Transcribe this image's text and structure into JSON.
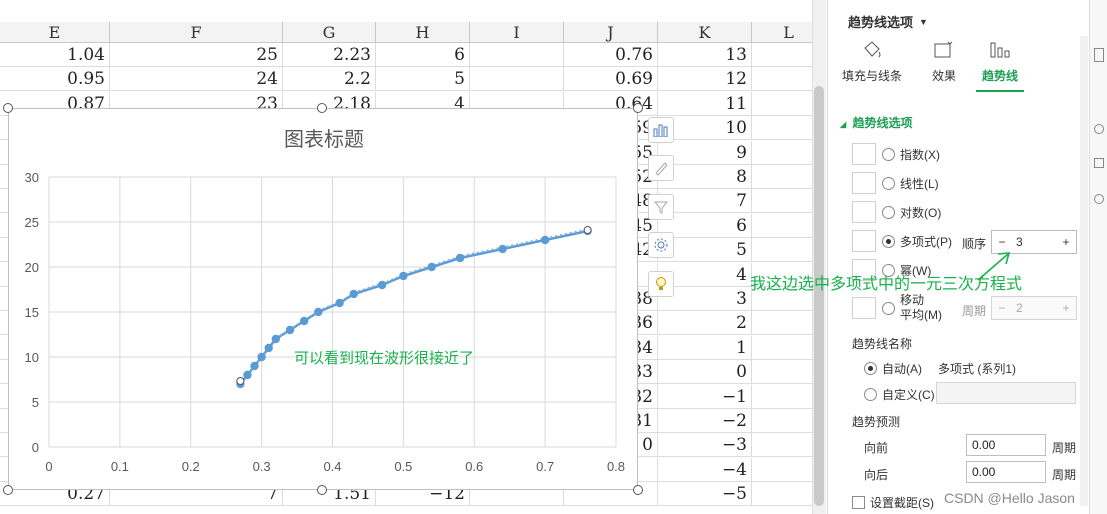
{
  "columns": [
    "E",
    "F",
    "G",
    "H",
    "I",
    "J",
    "K",
    "L"
  ],
  "rows": [
    [
      "1.04",
      "25",
      "2.23",
      "6",
      "",
      "0.76",
      "13",
      ""
    ],
    [
      "0.95",
      "24",
      "2.2",
      "5",
      "",
      "0.69",
      "12",
      ""
    ],
    [
      "0.87",
      "23",
      "2.18",
      "4",
      "",
      "0.64",
      "11",
      ""
    ],
    [
      "",
      "",
      "",
      "",
      "",
      "59",
      "10",
      ""
    ],
    [
      "",
      "",
      "",
      "",
      "",
      "55",
      "9",
      ""
    ],
    [
      "",
      "",
      "",
      "",
      "",
      "52",
      "8",
      ""
    ],
    [
      "",
      "",
      "",
      "",
      "",
      "48",
      "7",
      ""
    ],
    [
      "",
      "",
      "",
      "",
      "",
      "45",
      "6",
      ""
    ],
    [
      "",
      "",
      "",
      "",
      "",
      "42",
      "5",
      ""
    ],
    [
      "",
      "",
      "",
      "",
      "",
      "",
      "4",
      ""
    ],
    [
      "",
      "",
      "",
      "",
      "",
      "38",
      "3",
      ""
    ],
    [
      "",
      "",
      "",
      "",
      "",
      "36",
      "2",
      ""
    ],
    [
      "",
      "",
      "",
      "",
      "",
      "34",
      "1",
      ""
    ],
    [
      "",
      "",
      "",
      "",
      "",
      "33",
      "0",
      ""
    ],
    [
      "",
      "",
      "",
      "",
      "",
      "32",
      "−1",
      ""
    ],
    [
      "",
      "",
      "",
      "",
      "",
      "31",
      "−2",
      ""
    ],
    [
      "",
      "",
      "",
      "",
      "",
      "0",
      "−3",
      ""
    ],
    [
      "",
      "",
      "",
      "",
      "",
      "",
      "−4",
      ""
    ],
    [
      "0.27",
      "7",
      "1.51",
      "−12",
      "",
      "",
      "−5",
      ""
    ]
  ],
  "chart_data": {
    "type": "scatter",
    "title": "图表标题",
    "xlim": [
      0,
      0.8
    ],
    "ylim": [
      0,
      30
    ],
    "xticks": [
      "0",
      "0.1",
      "0.2",
      "0.3",
      "0.4",
      "0.5",
      "0.6",
      "0.7",
      "0.8"
    ],
    "yticks": [
      "0",
      "5",
      "10",
      "15",
      "20",
      "25",
      "30"
    ],
    "grid": true,
    "series": [
      {
        "x": [
          0.27,
          0.28,
          0.29,
          0.3,
          0.31,
          0.32,
          0.34,
          0.36,
          0.38,
          0.41,
          0.43,
          0.47,
          0.5,
          0.54,
          0.58,
          0.64,
          0.7,
          0.76
        ],
        "y": [
          7,
          8,
          9,
          10,
          11,
          12,
          13,
          14,
          15,
          16,
          17,
          18,
          19,
          20,
          21,
          22,
          23,
          24
        ]
      }
    ],
    "trendline": "polynomial",
    "trendline_order": 3,
    "color": "#5b9bd5"
  },
  "chart_tools": [
    "chart-elements",
    "chart-style",
    "chart-filter",
    "chart-settings",
    "chart-idea"
  ],
  "annotations": {
    "chart_note": "可以看到现在波形很接近了",
    "panel_note": "我这边选中多项式中的一元三次方程式"
  },
  "panel": {
    "header": "趋势线选项",
    "tabs": [
      "填充与线条",
      "效果",
      "趋势线"
    ],
    "section": "趋势线选项",
    "types": [
      {
        "label": "指数(X)",
        "selected": false
      },
      {
        "label": "线性(L)",
        "selected": false
      },
      {
        "label": "对数(O)",
        "selected": false
      },
      {
        "label": "多项式(P)",
        "selected": true
      },
      {
        "label": "幂(W)",
        "selected": false
      },
      {
        "label": "移动\n平均(M)",
        "selected": false
      }
    ],
    "order_label": "顺序",
    "order_value": "3",
    "period_label": "周期",
    "period_value": "2",
    "name_section": "趋势线名称",
    "auto_label": "自动(A)",
    "auto_value": "多项式 (系列1)",
    "custom_label": "自定义(C)",
    "forecast_section": "趋势预测",
    "forward_label": "向前",
    "forward_value": "0.00",
    "backward_label": "向后",
    "backward_value": "0.00",
    "period_unit": "周期",
    "intercept_label": "设置截距(S)"
  },
  "watermark": "CSDN @Hello Jason"
}
